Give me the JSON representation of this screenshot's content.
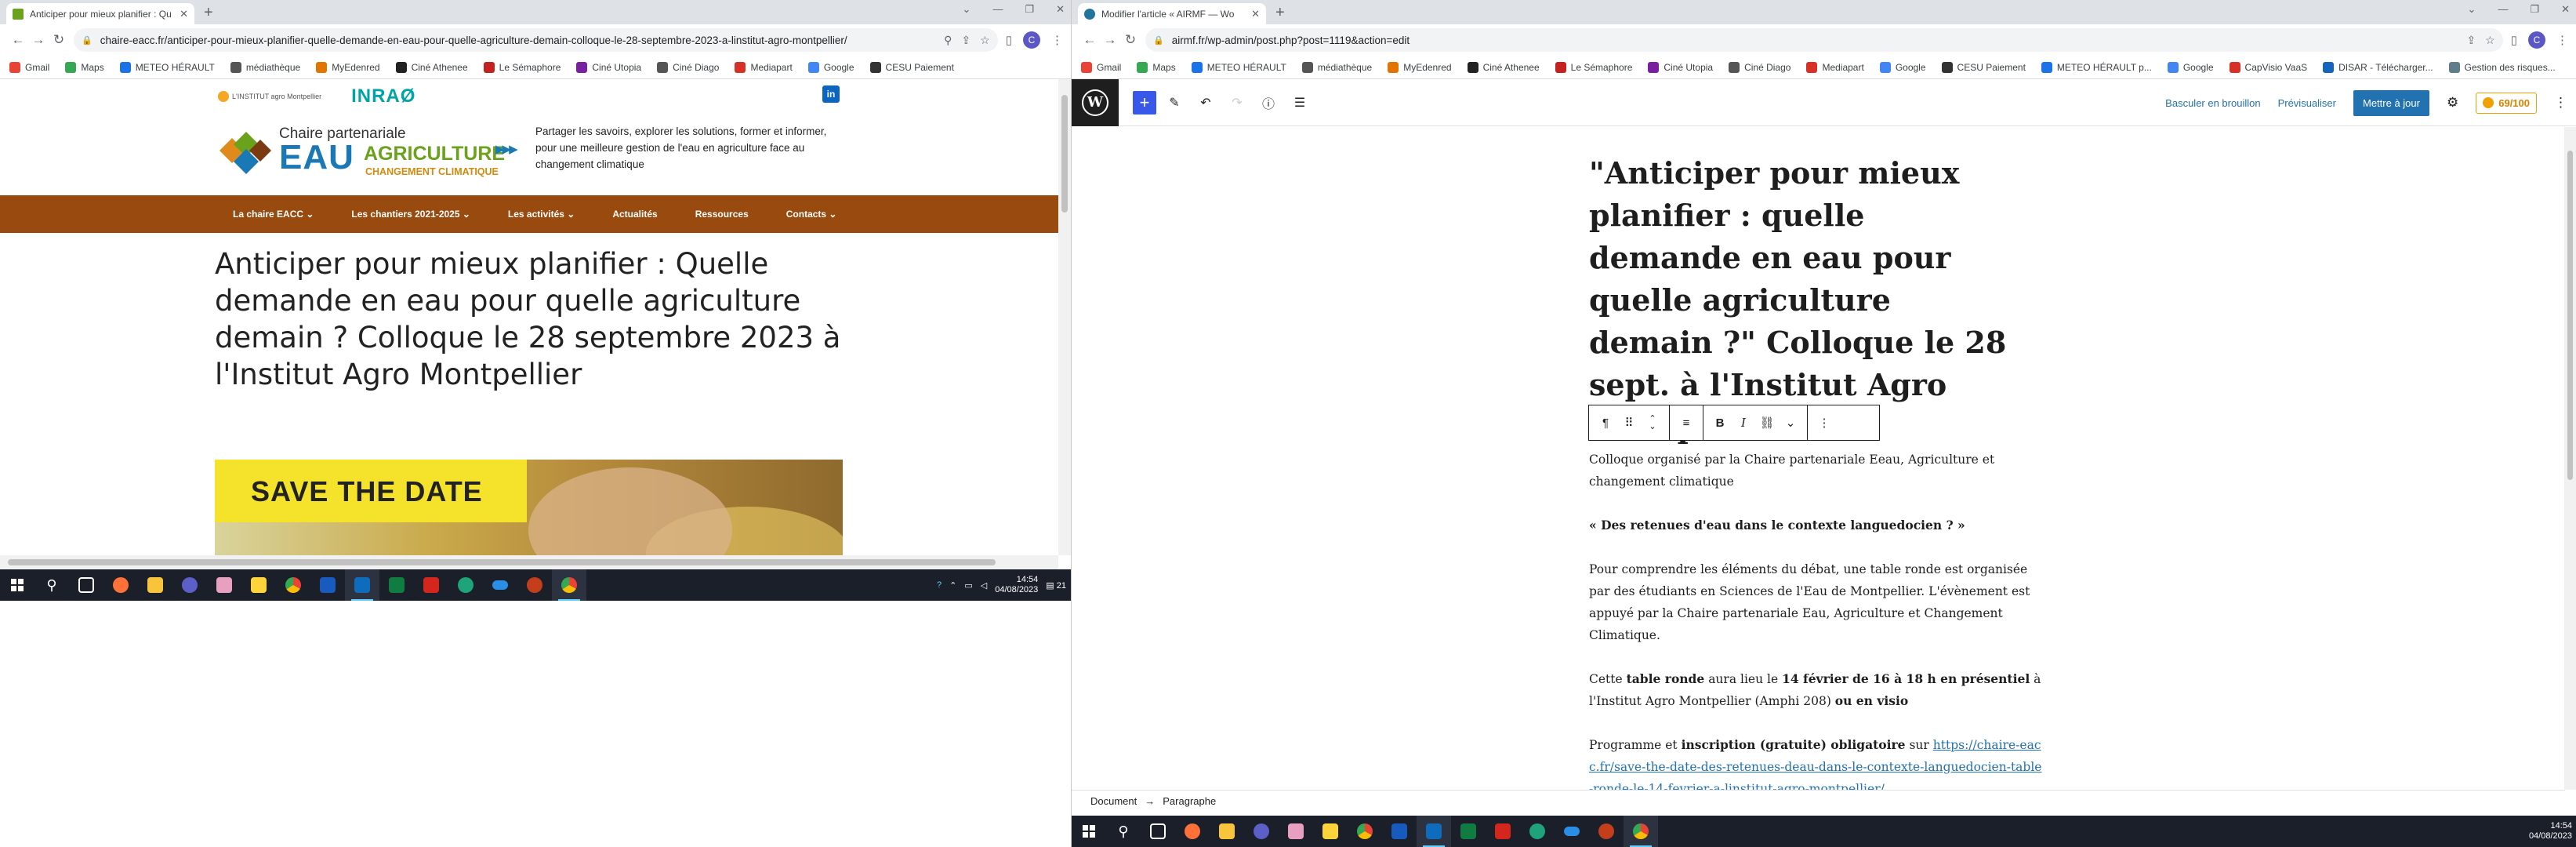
{
  "left": {
    "tab_title": "Anticiper pour mieux planifier : Qu",
    "url": "chaire-eacc.fr/anticiper-pour-mieux-planifier-quelle-demande-en-eau-pour-quelle-agriculture-demain-colloque-le-28-septembre-2023-a-linstitut-agro-montpellier/",
    "profile_letter": "C",
    "bookmarks": [
      "Gmail",
      "Maps",
      "METEO HÉRAULT",
      "médiathèque",
      "MyEdenred",
      "Ciné Athenee",
      "Le Sémaphore",
      "Ciné Utopia",
      "Ciné Diago",
      "Mediapart",
      "Google",
      "CESU Paiement"
    ],
    "site": {
      "institut_logo": "L'INSTITUT agro Montpellier",
      "inrae_logo": "INRAØ",
      "linkedin": "in",
      "chaire_label": "Chaire partenariale",
      "chaire_eau": "EAU",
      "chaire_agri": "AGRICULTURE",
      "chaire_cc": "CHANGEMENT CLIMATIQUE",
      "tagline": "Partager les savoirs, explorer les solutions, former et informer, pour une meilleure gestion de l'eau en agriculture face au changement climatique",
      "menu": [
        "La chaire EACC ⌄",
        "Les chantiers 2021-2025 ⌄",
        "Les activités ⌄",
        "Actualités",
        "Ressources",
        "Contacts ⌄"
      ],
      "title": "Anticiper pour mieux planifier : Quelle demande en eau pour quelle agriculture demain ? Colloque le 28 septembre 2023 à l'Institut Agro Montpellier",
      "banner_text": "SAVE THE DATE"
    },
    "clock_time": "14:54",
    "clock_date": "04/08/2023",
    "notif_count": "21"
  },
  "right": {
    "tab_title": "Modifier l'article « AIRMF — Wo",
    "url": "airmf.fr/wp-admin/post.php?post=1119&action=edit",
    "profile_letter": "C",
    "bookmarks": [
      "Gmail",
      "Maps",
      "METEO HÉRAULT",
      "médiathèque",
      "MyEdenred",
      "Ciné Athenee",
      "Le Sémaphore",
      "Ciné Utopia",
      "Ciné Diago",
      "Mediapart",
      "Google",
      "CESU Paiement",
      "METEO HÉRAULT p...",
      "Google",
      "CapVisio VaaS",
      "DISAR - Télécharger...",
      "Gestion des risques..."
    ],
    "wp": {
      "switch_draft": "Basculer en brouillon",
      "preview": "Prévisualiser",
      "update": "Mettre à jour",
      "score": "69/100",
      "title": "\"Anticiper pour mieux planifier : quelle demande en eau pour quelle agriculture demain ?\" Colloque le 28 sept. à l'Institut Agro Montpellier",
      "p1": "Colloque organisé par la Chaire partenariale Eeau, Agriculture et changement climatique",
      "p2": "« Des retenues d'eau dans le contexte languedocien ? »",
      "p3": "Pour comprendre les éléments du débat,  une table ronde est organisée  par des étudiants en Sciences de l'Eau de Montpellier.   L'évènement est appuyé par la Chaire partenariale Eau, Agriculture et Changement Climatique.",
      "p4_a": "Cette ",
      "p4_b": "table ronde",
      "p4_c": "  aura lieu le ",
      "p4_d": "14 février de 16 à 18 h  en présentiel",
      "p4_e": "   à l'Institut Agro Montpellier  (Amphi 208) ",
      "p4_f": "ou  en visio",
      "p5_a": "Programme et ",
      "p5_b": "inscription (gratuite)  obligatoire",
      "p5_c": " sur  ",
      "p5_link": "https://chaire-eacc.fr/save-the-date-des-retenues-deau-dans-le-contexte-languedocien-table-ronde-le-14-fevrier-a-linstitut-agro-montpellier/",
      "breadcrumb_doc": "Document",
      "breadcrumb_sep": "→",
      "breadcrumb_block": "Paragraphe"
    },
    "clock_time": "14:54",
    "clock_date": "04/08/2023"
  },
  "colors": {
    "menu_brown": "#994a0f",
    "wp_blue": "#2271b1",
    "taskbar": "#1b1f2a"
  }
}
